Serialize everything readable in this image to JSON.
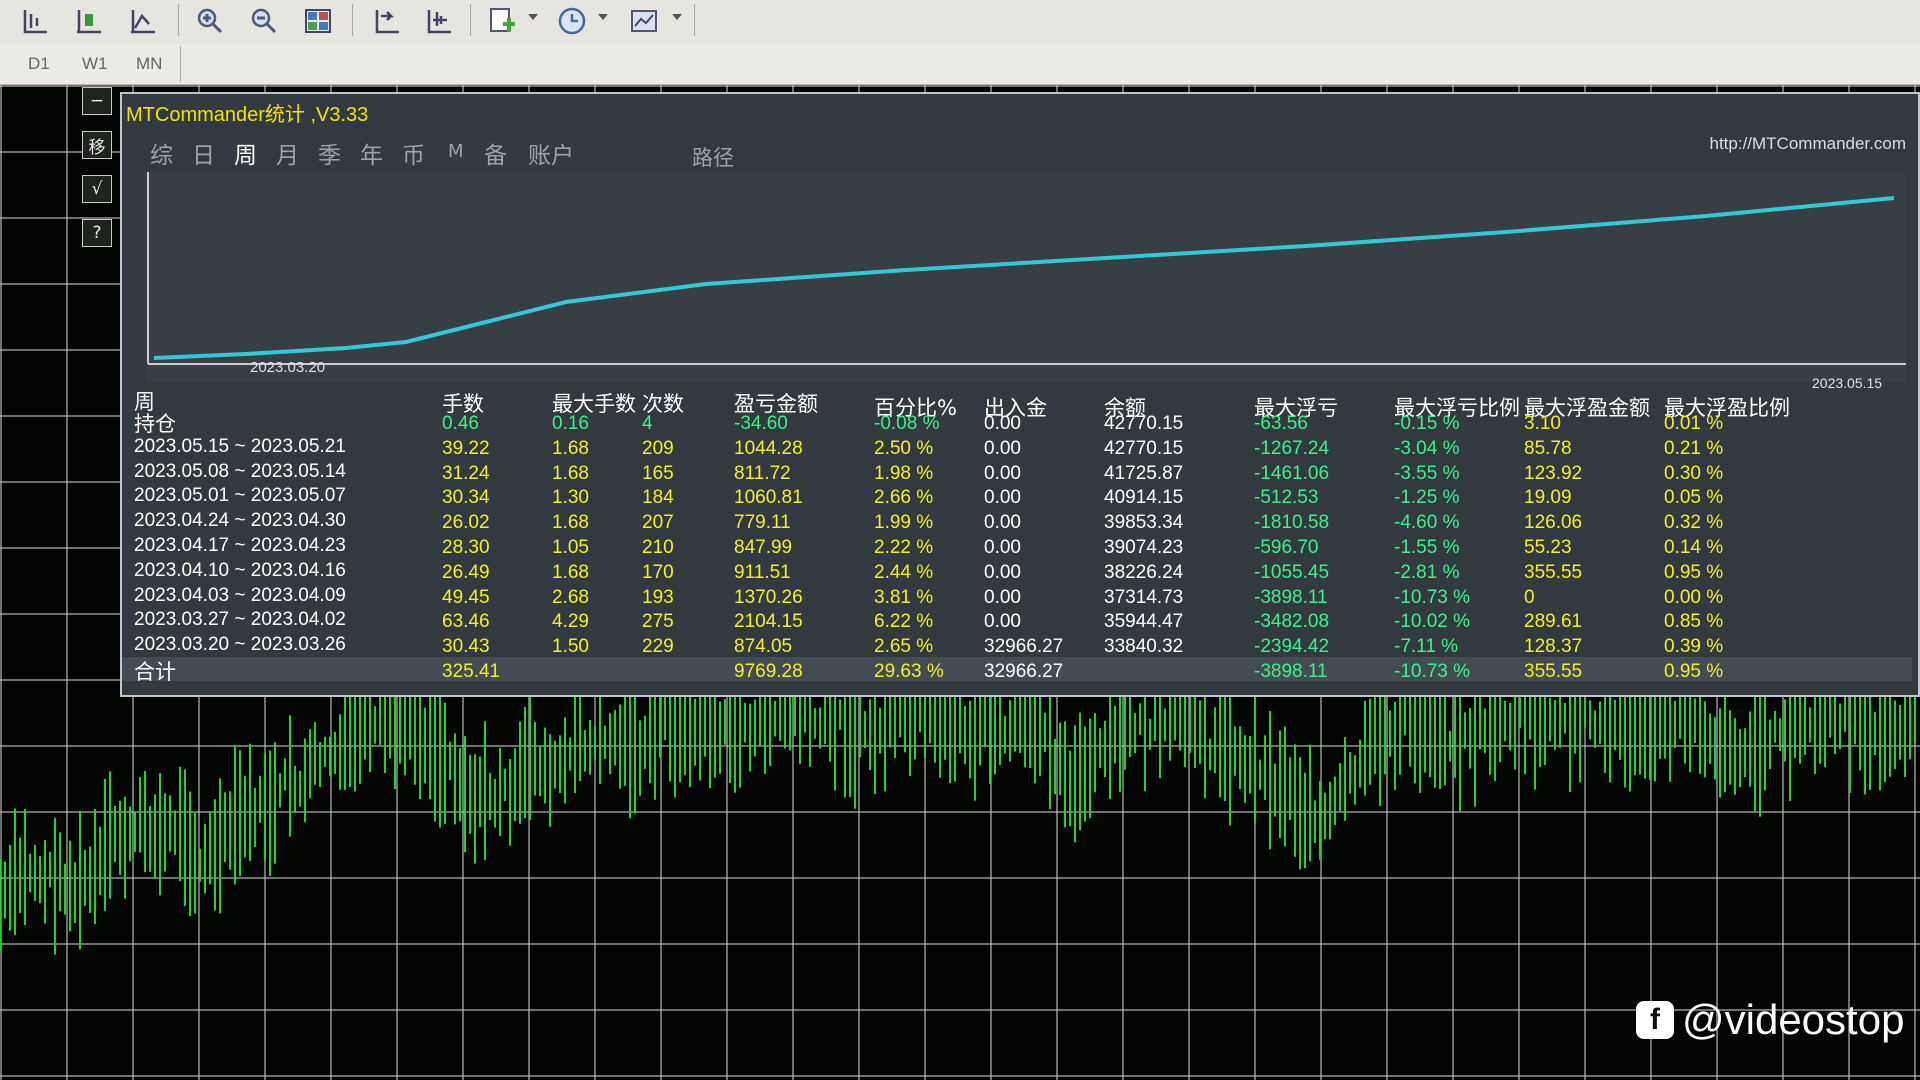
{
  "toolbar": {
    "icons": [
      "chart-bar-icon",
      "chart-candle-icon",
      "chart-line-icon",
      "zoom-in-icon",
      "zoom-out-icon",
      "tile-windows-icon",
      "chart-shift-icon",
      "autoscroll-icon",
      "indicators-icon",
      "periods-clock-icon",
      "templates-icon"
    ]
  },
  "periods": [
    "D1",
    "W1",
    "MN"
  ],
  "side_buttons": [
    "−",
    "移",
    "√",
    "?"
  ],
  "panel": {
    "title": "MTCommander统计 ,V3.33",
    "url": "http://MTCommander.com",
    "tabs": [
      "综",
      "日",
      "周",
      "月",
      "季",
      "年",
      "币",
      "M",
      "备",
      "账户"
    ],
    "active_tab": "周",
    "path_label": "路径",
    "chart_start_date": "2023.03.20",
    "chart_end_date": "2023.05.15"
  },
  "table": {
    "period_header": "周",
    "columns": [
      "手数",
      "最大手数",
      "次数",
      "盈亏金额",
      "百分比%",
      "出入金",
      "余额",
      "最大浮亏",
      "最大浮亏比例",
      "最大浮盈金额",
      "最大浮盈比例"
    ],
    "rows": [
      {
        "label": "持仓",
        "vals": [
          "0.46",
          "0.16",
          "4",
          "-34.60",
          "-0.08 %",
          "0.00",
          "42770.15",
          "-63.56",
          "-0.15 %",
          "3.10",
          "0.01 %"
        ]
      },
      {
        "label": "2023.05.15 ~ 2023.05.21",
        "vals": [
          "39.22",
          "1.68",
          "209",
          "1044.28",
          "2.50 %",
          "0.00",
          "42770.15",
          "-1267.24",
          "-3.04 %",
          "85.78",
          "0.21 %"
        ]
      },
      {
        "label": "2023.05.08 ~ 2023.05.14",
        "vals": [
          "31.24",
          "1.68",
          "165",
          "811.72",
          "1.98 %",
          "0.00",
          "41725.87",
          "-1461.06",
          "-3.55 %",
          "123.92",
          "0.30 %"
        ]
      },
      {
        "label": "2023.05.01 ~ 2023.05.07",
        "vals": [
          "30.34",
          "1.30",
          "184",
          "1060.81",
          "2.66 %",
          "0.00",
          "40914.15",
          "-512.53",
          "-1.25 %",
          "19.09",
          "0.05 %"
        ]
      },
      {
        "label": "2023.04.24 ~ 2023.04.30",
        "vals": [
          "26.02",
          "1.68",
          "207",
          "779.11",
          "1.99 %",
          "0.00",
          "39853.34",
          "-1810.58",
          "-4.60 %",
          "126.06",
          "0.32 %"
        ]
      },
      {
        "label": "2023.04.17 ~ 2023.04.23",
        "vals": [
          "28.30",
          "1.05",
          "210",
          "847.99",
          "2.22 %",
          "0.00",
          "39074.23",
          "-596.70",
          "-1.55 %",
          "55.23",
          "0.14 %"
        ]
      },
      {
        "label": "2023.04.10 ~ 2023.04.16",
        "vals": [
          "26.49",
          "1.68",
          "170",
          "911.51",
          "2.44 %",
          "0.00",
          "38226.24",
          "-1055.45",
          "-2.81 %",
          "355.55",
          "0.95 %"
        ]
      },
      {
        "label": "2023.04.03 ~ 2023.04.09",
        "vals": [
          "49.45",
          "2.68",
          "193",
          "1370.26",
          "3.81 %",
          "0.00",
          "37314.73",
          "-3898.11",
          "-10.73 %",
          "0",
          "0.00 %"
        ]
      },
      {
        "label": "2023.03.27 ~ 2023.04.02",
        "vals": [
          "63.46",
          "4.29",
          "275",
          "2104.15",
          "6.22 %",
          "0.00",
          "35944.47",
          "-3482.08",
          "-10.02 %",
          "289.61",
          "0.85 %"
        ]
      },
      {
        "label": "2023.03.20 ~ 2023.03.26",
        "vals": [
          "30.43",
          "1.50",
          "229",
          "874.05",
          "2.65 %",
          "32966.27",
          "33840.32",
          "-2394.42",
          "-7.11 %",
          "128.37",
          "0.39 %"
        ]
      }
    ],
    "total": {
      "label": "合计",
      "vals": [
        "325.41",
        "",
        "",
        "9769.28",
        "29.63 %",
        "32966.27",
        "",
        "-3898.11",
        "-10.73 %",
        "355.55",
        "0.95 %"
      ]
    }
  },
  "watermark": {
    "icon": "facebook-icon",
    "text": "@videostop"
  },
  "colors": {
    "yellow": "#f4ef28",
    "green": "#3ef08a",
    "curve": "#32c9d6",
    "candle": "#27d12b"
  }
}
